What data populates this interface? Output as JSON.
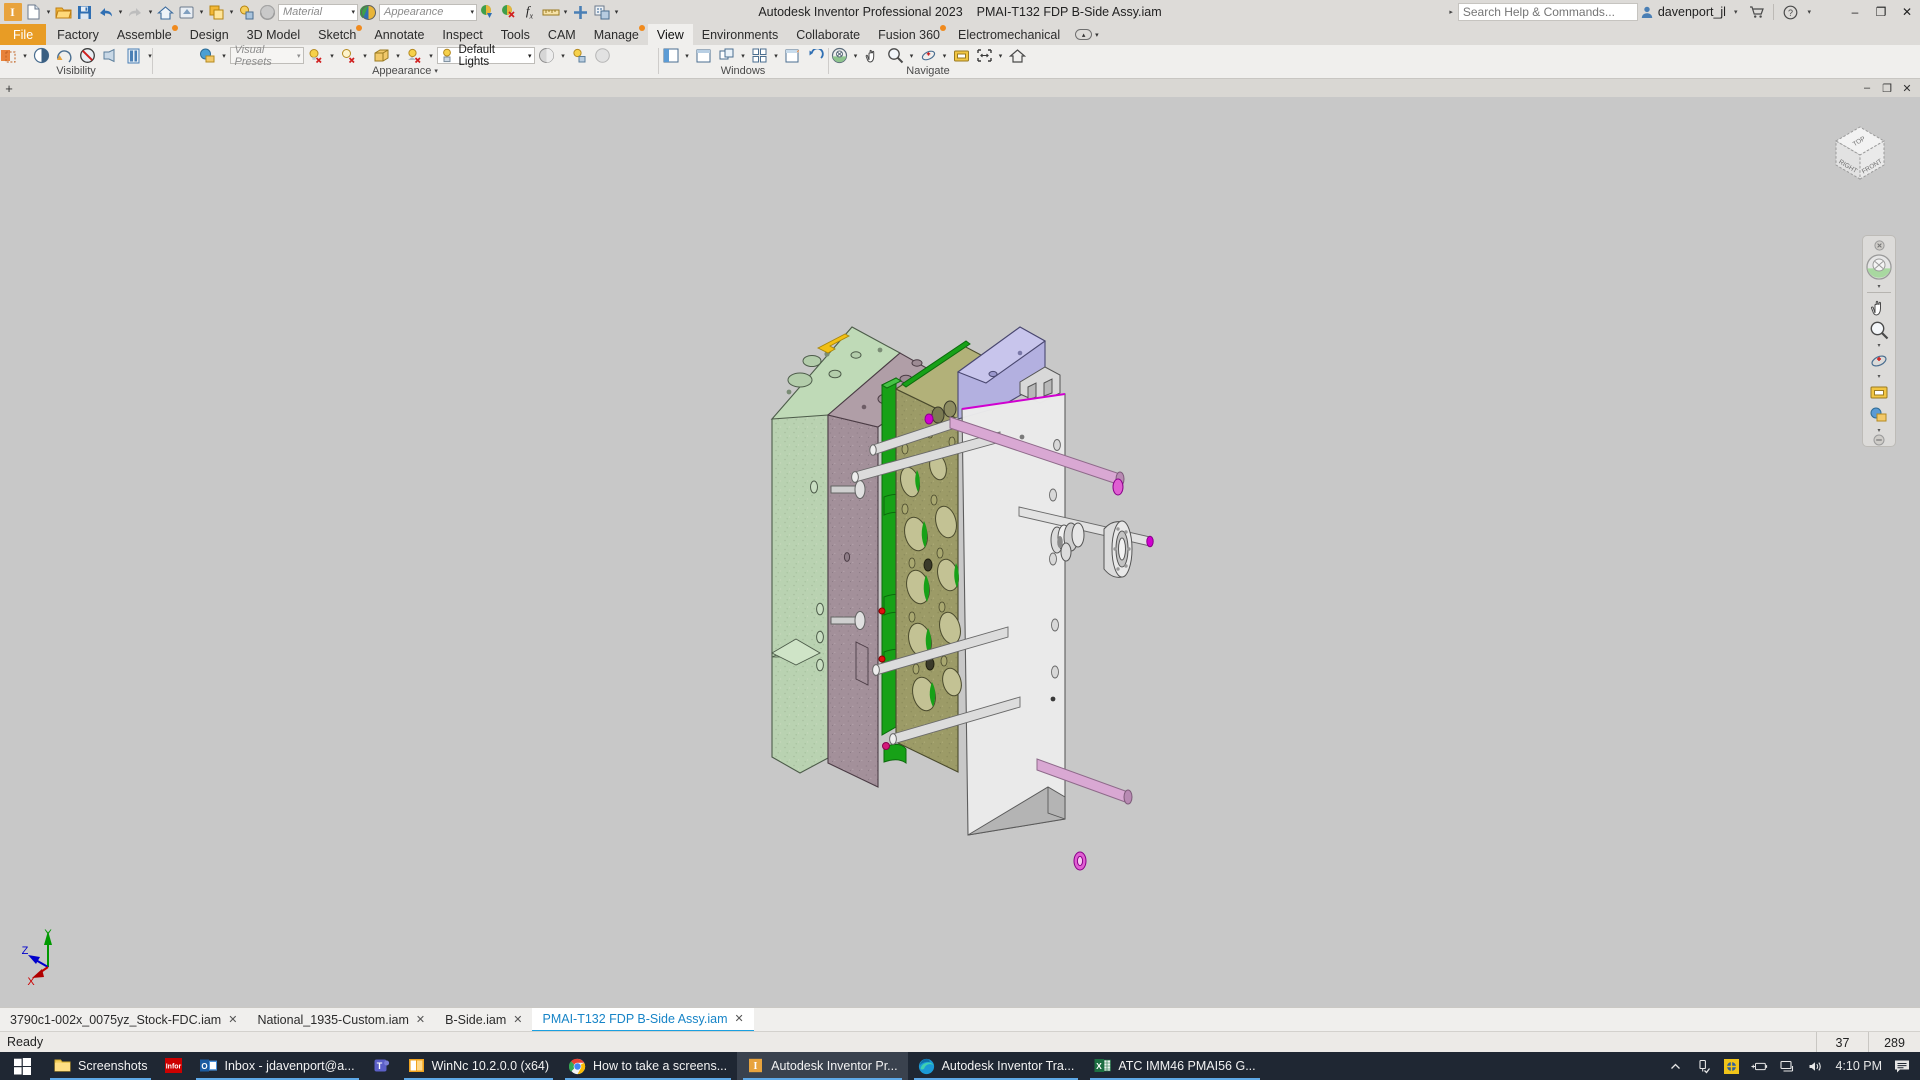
{
  "titlebar": {
    "app_logo": "inventor-logo-icon",
    "quick_access": [
      {
        "name": "new-document-icon",
        "label": "New"
      },
      {
        "name": "open-document-icon",
        "label": "Open"
      },
      {
        "name": "save-icon",
        "label": "Save"
      },
      {
        "name": "undo-icon",
        "label": "Undo"
      },
      {
        "name": "redo-icon",
        "label": "Redo"
      },
      {
        "name": "home-icon",
        "label": "Home"
      },
      {
        "name": "update-icon",
        "label": "Update"
      },
      {
        "name": "select-icon",
        "label": "Select"
      },
      {
        "name": "material-sphere-icon",
        "label": "Material Sphere"
      }
    ],
    "material_placeholder": "Material",
    "appearance_placeholder": "Appearance",
    "extra_icons": [
      {
        "name": "clear-appearance-icon",
        "label": "Adjust"
      },
      {
        "name": "appearance-remove-icon",
        "label": "Clear"
      },
      {
        "name": "parameters-fx-icon",
        "label": "fx"
      },
      {
        "name": "measure-icon",
        "label": "Measure"
      },
      {
        "name": "plus-icon",
        "label": "Add"
      },
      {
        "name": "content-center-icon",
        "label": "Content Center"
      },
      {
        "name": "qat-overflow-icon",
        "label": "Customize"
      }
    ],
    "app_title": "Autodesk Inventor Professional 2023",
    "document_name": "PMAI-T132 FDP B-Side Assy.iam",
    "search_placeholder": "Search Help & Commands...",
    "user_name": "davenport_jl",
    "cart_icon": "shopping-cart-icon",
    "help_icon": "help-question-icon",
    "window_controls": {
      "minimize": "–",
      "restore": "❐",
      "close": "✕"
    }
  },
  "ribbon_tabs": [
    {
      "label": "File",
      "type": "file",
      "dot": false
    },
    {
      "label": "Factory",
      "type": "normal",
      "dot": false
    },
    {
      "label": "Assemble",
      "type": "normal",
      "dot": true
    },
    {
      "label": "Design",
      "type": "normal",
      "dot": false
    },
    {
      "label": "3D Model",
      "type": "normal",
      "dot": false
    },
    {
      "label": "Sketch",
      "type": "normal",
      "dot": true
    },
    {
      "label": "Annotate",
      "type": "normal",
      "dot": false
    },
    {
      "label": "Inspect",
      "type": "normal",
      "dot": false
    },
    {
      "label": "Tools",
      "type": "normal",
      "dot": false
    },
    {
      "label": "CAM",
      "type": "normal",
      "dot": false
    },
    {
      "label": "Manage",
      "type": "normal",
      "dot": true
    },
    {
      "label": "View",
      "type": "active",
      "dot": false
    },
    {
      "label": "Environments",
      "type": "normal",
      "dot": false
    },
    {
      "label": "Collaborate",
      "type": "normal",
      "dot": false
    },
    {
      "label": "Fusion 360",
      "type": "normal",
      "dot": true
    },
    {
      "label": "Electromechanical",
      "type": "normal",
      "dot": false
    }
  ],
  "ribbon_panels": {
    "visibility": {
      "label": "Visibility",
      "items": [
        {
          "name": "object-visibility-icon"
        },
        {
          "name": "half-section-view-icon"
        },
        {
          "name": "rotate-section-icon"
        },
        {
          "name": "no-section-icon"
        },
        {
          "name": "shadow-icon"
        },
        {
          "name": "component-opacity-icon"
        }
      ]
    },
    "appearance": {
      "label": "Appearance",
      "visual_presets_placeholder": "Visual Presets",
      "lights_value": "Default Lights",
      "items": [
        {
          "name": "visual-style-icon"
        },
        {
          "name": "shadows-off-icon"
        },
        {
          "name": "reflections-off-icon"
        },
        {
          "name": "ground-plane-icon"
        },
        {
          "name": "ray-tracing-off-icon"
        },
        {
          "name": "lighting-style-icon"
        },
        {
          "name": "orthographic-camera-icon"
        },
        {
          "name": "ground-shadow-icon"
        },
        {
          "name": "sphere-shading-icon"
        }
      ]
    },
    "windows": {
      "label": "Windows",
      "items": [
        {
          "name": "user-interface-icon"
        },
        {
          "name": "new-window-icon"
        },
        {
          "name": "arrange-windows-icon"
        },
        {
          "name": "tile-windows-icon"
        },
        {
          "name": "switch-windows-icon"
        },
        {
          "name": "restore-window-icon"
        }
      ]
    },
    "navigate": {
      "label": "Navigate",
      "items": [
        {
          "name": "navigation-wheel-icon"
        },
        {
          "name": "pan-icon"
        },
        {
          "name": "zoom-icon"
        },
        {
          "name": "orbit-icon"
        },
        {
          "name": "look-at-icon"
        },
        {
          "name": "zoom-all-icon"
        },
        {
          "name": "home-view-icon"
        }
      ]
    }
  },
  "document_window": {
    "plus_icon": "new-tab-plus-icon",
    "controls": {
      "minimize": "–",
      "restore": "❐",
      "close": "✕"
    }
  },
  "viewport": {
    "background_color": "#c8c8c8",
    "axis_labels": {
      "x": "X",
      "y": "Y",
      "z": "Z"
    },
    "axis_colors": {
      "x": "#d00000",
      "y": "#009900",
      "z": "#0000cc"
    },
    "viewcube": {
      "top": "TOP",
      "front": "FRONT",
      "right": "RIGHT"
    },
    "navigation_bar": [
      {
        "name": "steering-wheel-icon"
      },
      {
        "name": "pan-hand-icon"
      },
      {
        "name": "zoom-magnifier-icon"
      },
      {
        "name": "orbit-icon"
      },
      {
        "name": "look-at-icon"
      },
      {
        "name": "show-hidden-icon"
      }
    ],
    "model": {
      "description": "Exploded injection mould B-side assembly",
      "colors": {
        "light_green_plate": "#bcd6b4",
        "mauve_plate": "#a8939c",
        "olive_plate": "#9b9a65",
        "lavender_plate": "#b3b0e0",
        "white_plate": "#ececec",
        "green_insert": "#17a117",
        "yellow_tag": "#f2c013",
        "pink_rod": "#d9a8d3",
        "magenta_edge": "#d000d0",
        "grey_pin": "#dcdcdc",
        "red_marker": "#e01010"
      }
    }
  },
  "document_tabs": [
    {
      "label": "3790c1-002x_0075yz_Stock-FDC.iam",
      "active": false
    },
    {
      "label": "National_1935-Custom.iam",
      "active": false
    },
    {
      "label": "B-Side.iam",
      "active": false
    },
    {
      "label": "PMAI-T132 FDP B-Side Assy.iam",
      "active": true
    }
  ],
  "status_bar": {
    "message": "Ready",
    "cells": [
      "37",
      "289"
    ]
  },
  "taskbar": {
    "start_icon": "windows-start-icon",
    "items": [
      {
        "label": "Screenshots",
        "icon": "folder-icon",
        "running": true,
        "active": false
      },
      {
        "label": "",
        "icon": "infor-icon",
        "running": false,
        "active": false
      },
      {
        "label": "Inbox - jdavenport@a...",
        "icon": "outlook-icon",
        "running": true,
        "active": false
      },
      {
        "label": "",
        "icon": "teams-icon",
        "running": false,
        "active": false
      },
      {
        "label": "WinNc 10.2.0.0 (x64)",
        "icon": "winnc-icon",
        "running": true,
        "active": false
      },
      {
        "label": "How to take a screens...",
        "icon": "chrome-icon",
        "running": true,
        "active": false
      },
      {
        "label": "Autodesk Inventor Pr...",
        "icon": "inventor-icon",
        "running": true,
        "active": true
      },
      {
        "label": "Autodesk Inventor Tra...",
        "icon": "edge-icon",
        "running": true,
        "active": false
      },
      {
        "label": "ATC IMM46 PMAI56 G...",
        "icon": "excel-icon",
        "running": true,
        "active": false
      }
    ],
    "tray": [
      {
        "name": "show-hidden-icons-chevron"
      },
      {
        "name": "usb-safely-remove-icon"
      },
      {
        "name": "app-tray-icon"
      },
      {
        "name": "battery-plugged-icon"
      },
      {
        "name": "network-icon"
      },
      {
        "name": "volume-icon"
      }
    ],
    "clock": "4:10 PM",
    "action_center_icon": "notification-icon"
  }
}
